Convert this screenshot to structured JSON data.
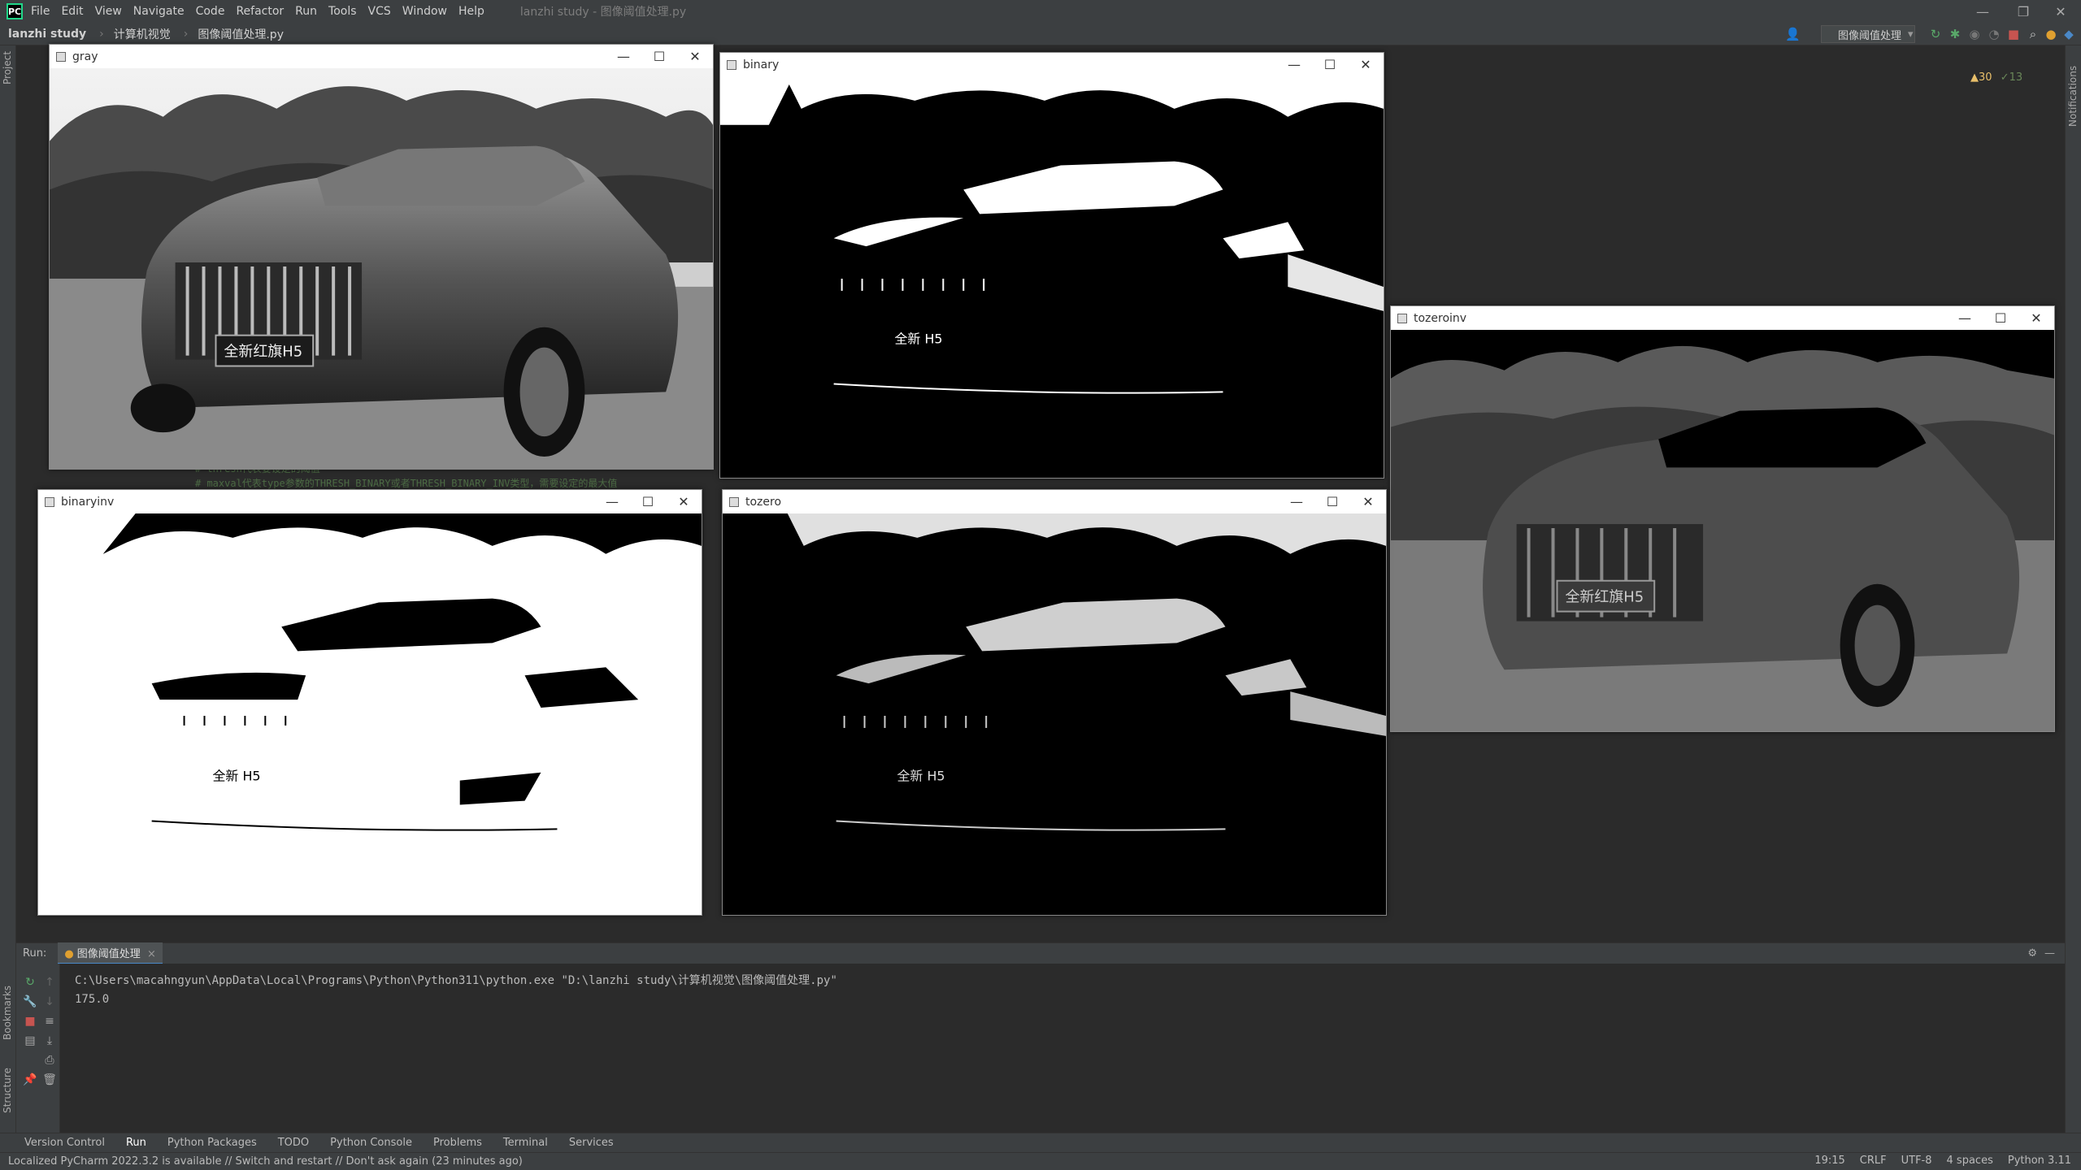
{
  "app": {
    "logo": "PC",
    "menu": [
      "File",
      "Edit",
      "View",
      "Navigate",
      "Code",
      "Refactor",
      "Run",
      "Tools",
      "VCS",
      "Window",
      "Help"
    ],
    "window_title": "lanzhi study - 图像阈值处理.py",
    "window_controls": [
      "—",
      "❐",
      "✕"
    ]
  },
  "navbar": {
    "breadcrumbs": [
      "lanzhi study",
      "计算机视觉",
      "图像阈值处理.py"
    ],
    "run_config": "图像阈值处理",
    "inspections": {
      "warnings": "▲30",
      "ok": "✓13"
    }
  },
  "sidebar": {
    "project_label": "Project",
    "bookmarks_label": "Bookmarks",
    "structure_label": "Structure",
    "notifications_label": "Notifications"
  },
  "image_windows": [
    {
      "id": "gray",
      "title": "gray",
      "variant": "gray"
    },
    {
      "id": "binary",
      "title": "binary",
      "variant": "binary"
    },
    {
      "id": "tozeroinv",
      "title": "tozeroinv",
      "variant": "tozeroinv"
    },
    {
      "id": "binaryinv",
      "title": "binaryinv",
      "variant": "binaryinv"
    },
    {
      "id": "tozero",
      "title": "tozero",
      "variant": "tozero"
    }
  ],
  "image_window_controls": [
    "—",
    "☐",
    "✕"
  ],
  "plate_text": "全新红旗H5",
  "plate_text_threshold": "全新    H5",
  "editor_code_fragment": "# thresh代表要设定的阈值\n# maxval代表type参数的THRESH_BINARY或者THRESH_BINARY_INV类型，需要设定的最大值",
  "run": {
    "label": "Run:",
    "tab": "图像阈值处理",
    "command": "C:\\Users\\macahngyun\\AppData\\Local\\Programs\\Python\\Python311\\python.exe \"D:\\lanzhi study\\计算机视觉\\图像阈值处理.py\"",
    "output": "175.0"
  },
  "bottom_tabs": [
    "Version Control",
    "Run",
    "Python Packages",
    "TODO",
    "Python Console",
    "Problems",
    "Terminal",
    "Services"
  ],
  "status": {
    "message": "Localized PyCharm 2022.3.2 is available // Switch and restart // Don't ask again (23 minutes ago)",
    "position": "19:15",
    "line_sep": "CRLF",
    "encoding": "UTF-8",
    "indent": "4 spaces",
    "interpreter": "Python 3.11"
  },
  "colors": {
    "accent": "#4a88c7",
    "ide_bg": "#2b2b2b",
    "panel_bg": "#3c3f41"
  }
}
